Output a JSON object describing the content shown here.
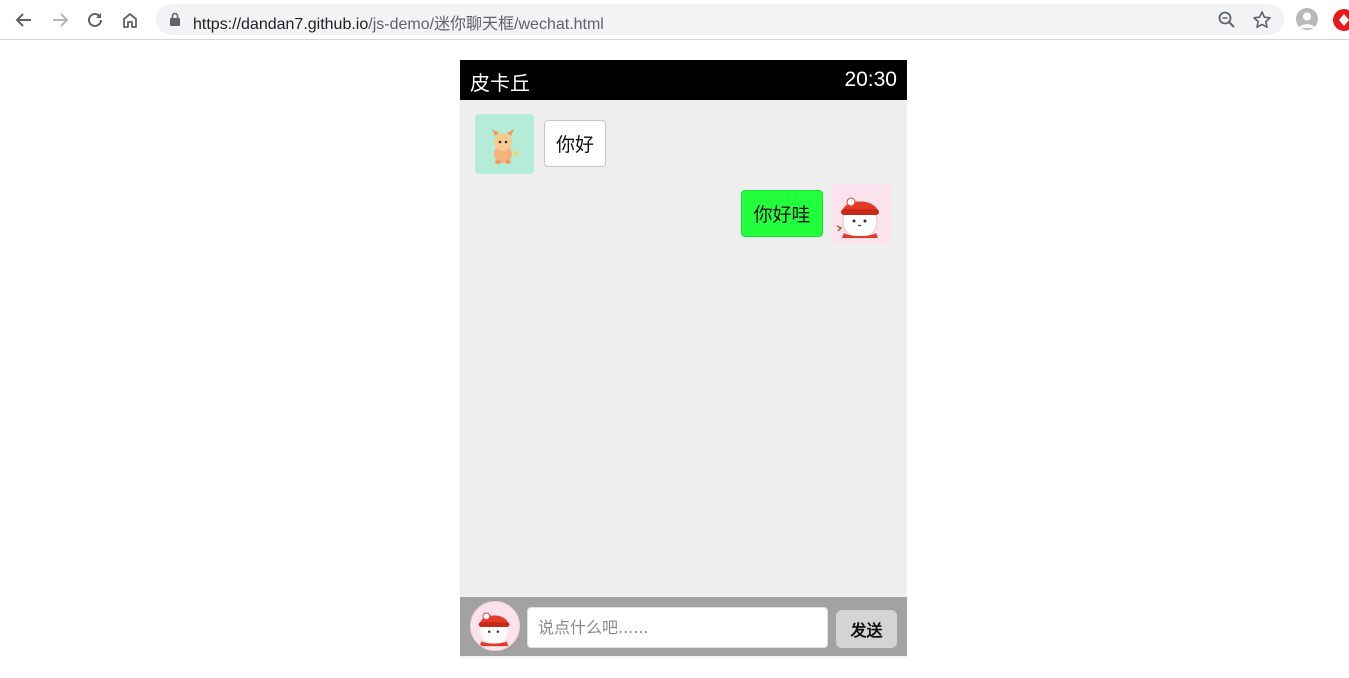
{
  "browser": {
    "url_host": "https://dandan7.github.io",
    "url_path": "/js-demo/迷你聊天框/wechat.html",
    "icons": [
      "back-icon",
      "forward-icon",
      "reload-icon",
      "home-icon",
      "lock-icon",
      "zoom-icon",
      "star-icon",
      "profile-icon",
      "extension-icon"
    ]
  },
  "chat": {
    "title": "皮卡丘",
    "time": "20:30",
    "messages": [
      {
        "side": "left",
        "text": "你好",
        "bubble_color": "#ffffff"
      },
      {
        "side": "right",
        "text": "你好哇",
        "bubble_color": "#22ff3c"
      }
    ],
    "input": {
      "value": "",
      "placeholder": "说点什么吧......"
    },
    "send_label": "发送"
  },
  "colors": {
    "header_bg": "#000000",
    "chat_bg": "#eeeeee",
    "inputbar_bg": "#a2a2a2",
    "my_bubble": "#22ff3c"
  }
}
